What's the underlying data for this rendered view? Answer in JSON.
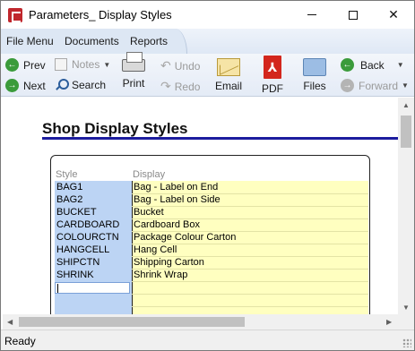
{
  "window": {
    "title": "Parameters_ Display Styles"
  },
  "menu": {
    "items": [
      "File Menu",
      "Documents",
      "Reports"
    ]
  },
  "toolbar": {
    "prev": "Prev",
    "next": "Next",
    "notes": "Notes",
    "search": "Search",
    "print": "Print",
    "undo": "Undo",
    "redo": "Redo",
    "email": "Email",
    "pdf": "PDF",
    "files": "Files",
    "back": "Back",
    "forward": "Forward"
  },
  "report": {
    "title": "Shop Display Styles",
    "headers": {
      "style": "Style",
      "display": "Display"
    },
    "rows": [
      {
        "style": "BAG1",
        "display": "Bag - Label on End"
      },
      {
        "style": "BAG2",
        "display": "Bag - Label on Side"
      },
      {
        "style": "BUCKET",
        "display": "Bucket"
      },
      {
        "style": "CARDBOARD",
        "display": "Cardboard Box"
      },
      {
        "style": "COLOURCTN",
        "display": "Package Colour Carton"
      },
      {
        "style": "HANGCELL",
        "display": "Hang Cell"
      },
      {
        "style": "SHIPCTN",
        "display": "Shipping Carton"
      },
      {
        "style": "SHRINK",
        "display": "Shrink Wrap"
      }
    ]
  },
  "status": {
    "text": "Ready"
  },
  "colors": {
    "style_col": "#bcd4f4",
    "display_col": "#ffffc0",
    "rule": "#1c1c9e",
    "accent_green": "#3b9b3b",
    "pdf_red": "#d3261c"
  }
}
